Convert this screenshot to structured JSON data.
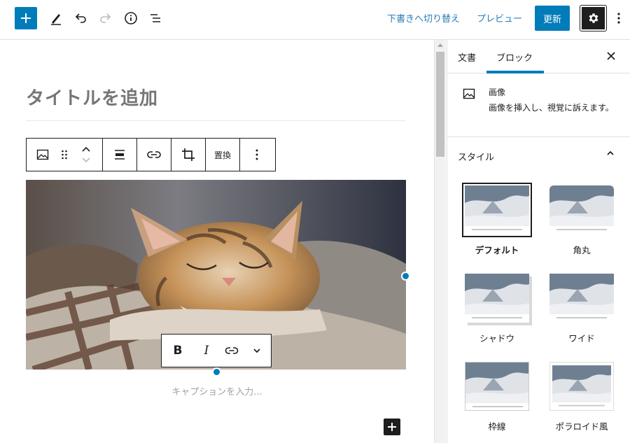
{
  "topbar": {
    "add_tooltip": "",
    "save_draft": "下書きへ切り替え",
    "preview": "プレビュー",
    "update": "更新"
  },
  "editor": {
    "title_placeholder": "タイトルを追加",
    "block_toolbar": {
      "replace": "置換"
    },
    "format_toolbar": {
      "bold": "B",
      "italic": "I"
    },
    "caption_placeholder": "キャプションを入力..."
  },
  "sidebar": {
    "tabs": [
      {
        "label": "文書",
        "active": false
      },
      {
        "label": "ブロック",
        "active": true
      }
    ],
    "block": {
      "name": "画像",
      "description": "画像を挿入し、視覚に訴えます。"
    },
    "styles": {
      "heading": "スタイル",
      "items": [
        {
          "label": "デフォルト",
          "selected": true
        },
        {
          "label": "角丸",
          "selected": false
        },
        {
          "label": "シャドウ",
          "selected": false
        },
        {
          "label": "ワイド",
          "selected": false
        },
        {
          "label": "枠線",
          "selected": false
        },
        {
          "label": "ポラロイド風",
          "selected": false
        }
      ]
    }
  },
  "colors": {
    "accent": "#007cba",
    "dark": "#1e1e1e"
  }
}
